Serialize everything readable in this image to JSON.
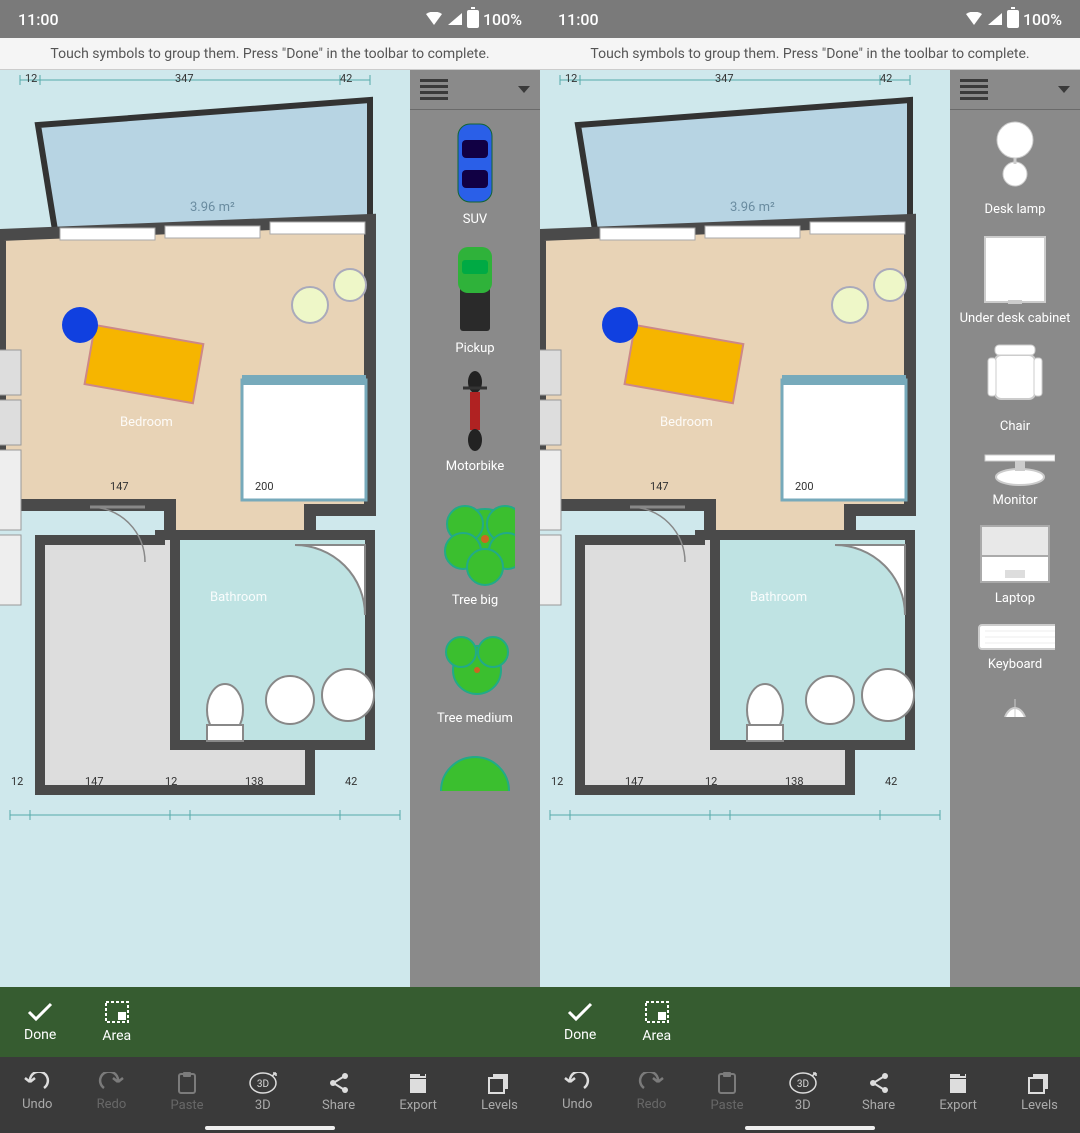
{
  "status": {
    "time": "11:00",
    "battery": "100%"
  },
  "hint": "Touch symbols to group them. Press \"Done\" in the toolbar to complete.",
  "floorplan": {
    "balcony_area": "3.96 m²",
    "room_bedroom": "Bedroom",
    "room_bathroom": "Bathroom",
    "dims": {
      "top_a": "12",
      "top_b": "347",
      "top_c": "42",
      "mid_a": "147",
      "mid_b": "200",
      "bot_a": "12",
      "bot_b": "147",
      "bot_c": "12",
      "bot_d": "138",
      "bot_e": "42"
    }
  },
  "panelA": {
    "items": [
      {
        "label": "SUV"
      },
      {
        "label": "Pickup"
      },
      {
        "label": "Motorbike"
      },
      {
        "label": "Tree big"
      },
      {
        "label": "Tree medium"
      }
    ]
  },
  "panelB": {
    "items": [
      {
        "label": "Desk lamp"
      },
      {
        "label": "Under desk cabinet"
      },
      {
        "label": "Chair"
      },
      {
        "label": "Monitor"
      },
      {
        "label": "Laptop"
      },
      {
        "label": "Keyboard"
      }
    ]
  },
  "actionbar": {
    "done": "Done",
    "area": "Area"
  },
  "bottombar": {
    "undo": "Undo",
    "redo": "Redo",
    "paste": "Paste",
    "td": "3D",
    "share": "Share",
    "export": "Export",
    "levels": "Levels"
  }
}
